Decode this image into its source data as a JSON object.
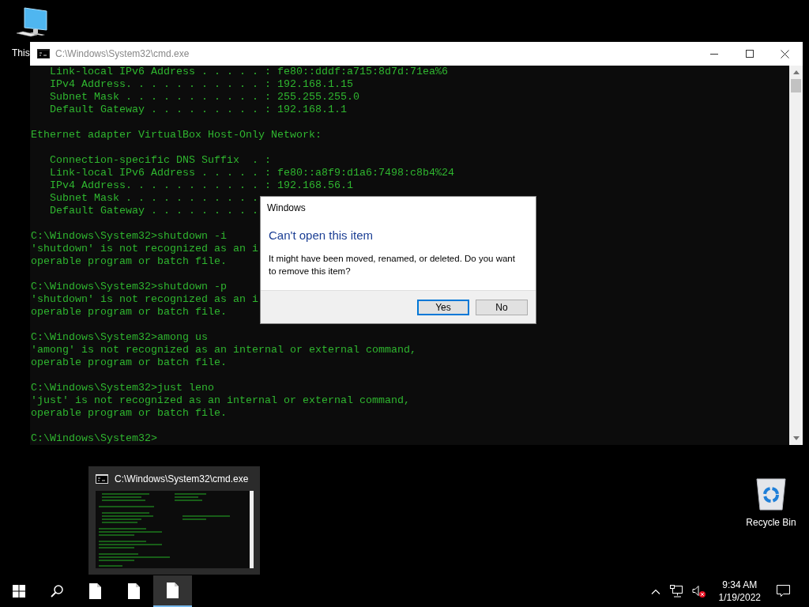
{
  "desktop_icons": [
    {
      "kind": "computer",
      "label": "This"
    },
    {
      "kind": "recycle-bin",
      "label": "Recycle Bin"
    }
  ],
  "console_window": {
    "title": "C:\\Windows\\System32\\cmd.exe",
    "blocks": [
      [
        "   Link-local IPv6 Address . . . . . : fe80::dddf:a715:8d7d:71ea%6",
        "   IPv4 Address. . . . . . . . . . . : 192.168.1.15",
        "   Subnet Mask . . . . . . . . . . . : 255.255.255.0",
        "   Default Gateway . . . . . . . . . : 192.168.1.1"
      ],
      [
        "Ethernet adapter VirtualBox Host-Only Network:"
      ],
      [
        "   Connection-specific DNS Suffix  . :",
        "   Link-local IPv6 Address . . . . . : fe80::a8f9:d1a6:7498:c8b4%24",
        "   IPv4 Address. . . . . . . . . . . : 192.168.56.1",
        "   Subnet Mask . . . . . . . . . . .",
        "   Default Gateway . . . . . . . . ."
      ],
      [
        "C:\\Windows\\System32>shutdown -i",
        "'shutdown' is not recognized as an i",
        "operable program or batch file."
      ],
      [
        "C:\\Windows\\System32>shutdown -p",
        "'shutdown' is not recognized as an i",
        "operable program or batch file."
      ],
      [
        "C:\\Windows\\System32>among us",
        "'among' is not recognized as an internal or external command,",
        "operable program or batch file."
      ],
      [
        "C:\\Windows\\System32>just leno",
        "'just' is not recognized as an internal or external command,",
        "operable program or batch file."
      ],
      [
        "C:\\Windows\\System32>"
      ]
    ]
  },
  "dialog": {
    "title": "Windows",
    "heading": "Can't open this item",
    "message": "It might have been moved, renamed, or deleted. Do you want to remove this item?",
    "buttons": [
      {
        "label": "Yes",
        "selected": true
      },
      {
        "label": "No",
        "selected": false
      }
    ]
  },
  "taskbar": {
    "apps": [
      {
        "selected": false
      },
      {
        "selected": false
      },
      {
        "selected": true
      }
    ],
    "thumbnail": {
      "title": "C:\\Windows\\System32\\cmd.exe"
    },
    "clock": {
      "time": "9:34 AM",
      "date": "1/19/2022"
    }
  }
}
